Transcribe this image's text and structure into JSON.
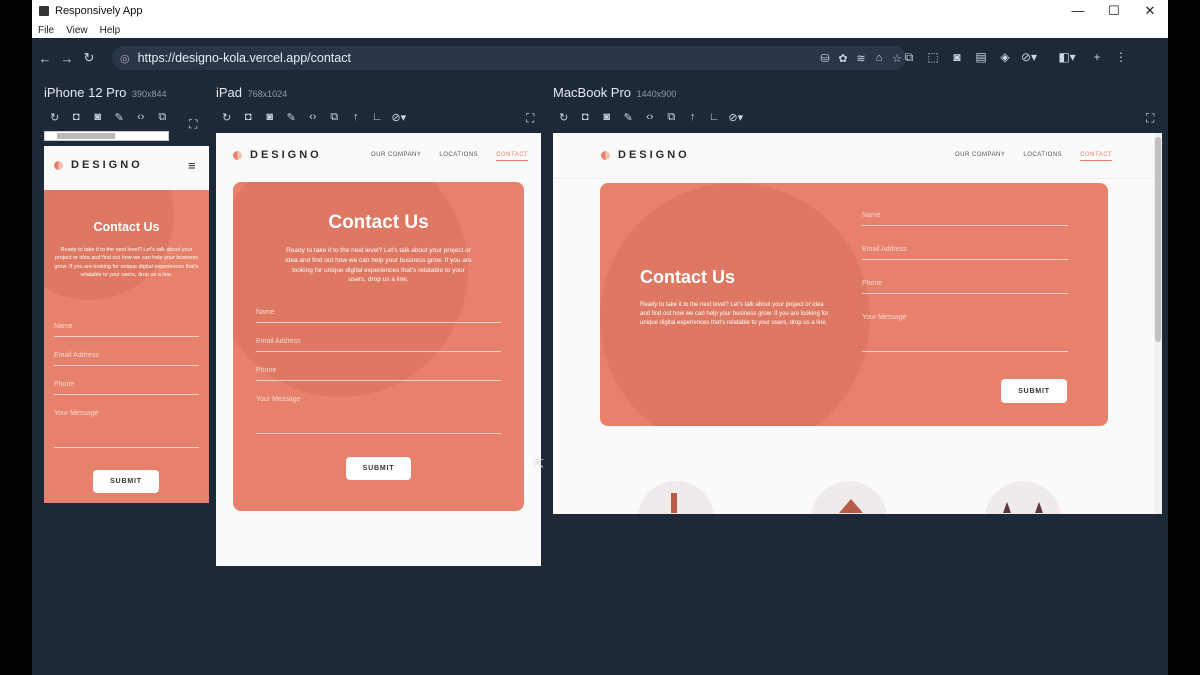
{
  "window": {
    "title": "Responsively App"
  },
  "menu": [
    "File",
    "View",
    "Help"
  ],
  "url": "https://designo-kola.vercel.app/contact",
  "devices": [
    {
      "name": "iPhone 12 Pro",
      "size": "390x844"
    },
    {
      "name": "iPad",
      "size": "768x1024"
    },
    {
      "name": "MacBook Pro",
      "size": "1440x900"
    }
  ],
  "site": {
    "logo": "DESIGNO",
    "nav": [
      "OUR COMPANY",
      "LOCATIONS",
      "CONTACT"
    ],
    "heading": "Contact Us",
    "body": "Ready to take it to the next level? Let's talk about your project or idea and find out how we can help your business grow. If you are looking for unique digital experiences that's relatable to your users, drop us a line.",
    "fields": [
      "Name",
      "Email Address",
      "Phone",
      "Your Message"
    ],
    "submit": "SUBMIT"
  },
  "colors": {
    "accent": "#e7816b",
    "app_bg": "#1d2838"
  }
}
